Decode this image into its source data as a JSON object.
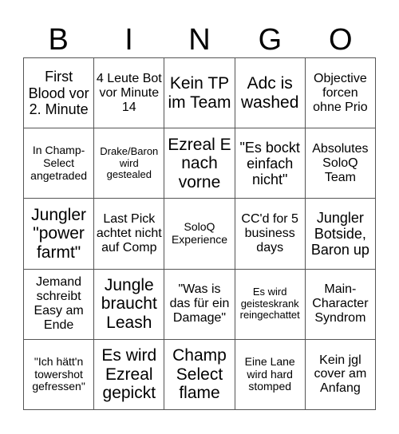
{
  "header": {
    "letters": [
      "B",
      "I",
      "N",
      "G",
      "O"
    ]
  },
  "grid": {
    "cells": [
      [
        "First Blood vor 2. Minute",
        "4 Leute Bot vor Minute 14",
        "Kein TP im Team",
        "Adc is washed",
        "Objective forcen ohne Prio"
      ],
      [
        "In Champ-Select angetraded",
        "Drake/Baron wird gestealed",
        "Ezreal E nach vorne",
        "\"Es bockt einfach nicht\"",
        "Absolutes SoloQ Team"
      ],
      [
        "Jungler \"power farmt\"",
        "Last Pick achtet nicht auf Comp",
        "SoloQ Experience",
        "CC'd for 5 business days",
        "Jungler Botside, Baron up"
      ],
      [
        "Jemand schreibt Easy am Ende",
        "Jungle braucht Leash",
        "\"Was is das für ein Damage\"",
        "Es wird geisteskrank reingechattet",
        "Main-Character Syndrom"
      ],
      [
        "\"Ich hätt'n towershot gefressen\"",
        "Es wird Ezreal gepickt",
        "Champ Select flame",
        "Eine Lane wird hard stomped",
        "Kein jgl cover am Anfang"
      ]
    ]
  }
}
